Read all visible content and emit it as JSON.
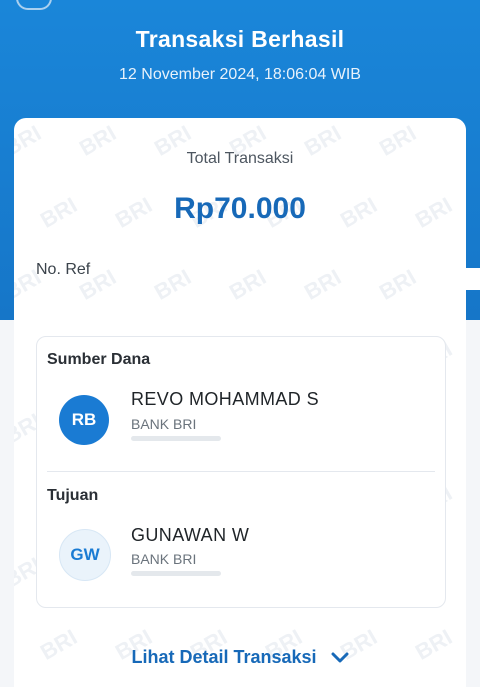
{
  "header": {
    "title": "Transaksi Berhasil",
    "datetime": "12 November 2024, 18:06:04 WIB"
  },
  "summary": {
    "total_label": "Total Transaksi",
    "total_amount": "Rp70.000",
    "ref_label": "No. Ref"
  },
  "watermark_text": "BRI",
  "source": {
    "section_label": "Sumber Dana",
    "initials": "RB",
    "name": "REVO MOHAMMAD S",
    "bank": "BANK BRI"
  },
  "destination": {
    "section_label": "Tujuan",
    "initials": "GW",
    "name": "GUNAWAN W",
    "bank": "BANK BRI"
  },
  "footer": {
    "detail_link": "Lihat Detail Transaksi"
  },
  "colors": {
    "header_blue": "#1a86d9",
    "accent_blue": "#1769b8"
  }
}
